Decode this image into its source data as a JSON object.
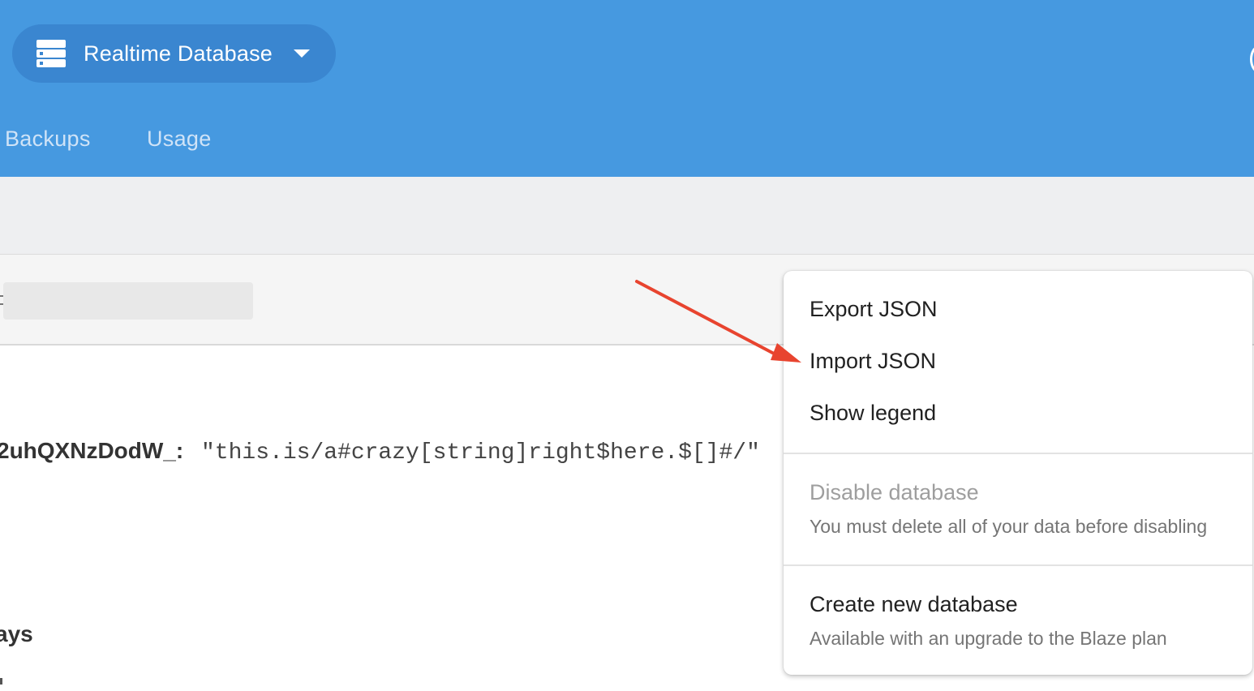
{
  "header": {
    "db_selector": {
      "title": "Realtime Database",
      "icon": "database-server-icon"
    },
    "tabs": [
      {
        "label": "Backups"
      },
      {
        "label": "Usage"
      }
    ],
    "colors": {
      "header_bg": "#4699e0",
      "selector_bg": "#3a86d0"
    }
  },
  "data_view": {
    "key": "2uhQXNzDodW_",
    "colon": ":",
    "value": "\"this.is/a#crazy[string]right$here.$[]#/\"",
    "partial_key": "ays"
  },
  "menu": {
    "items": [
      {
        "label": "Export JSON"
      },
      {
        "label": "Import JSON"
      },
      {
        "label": "Show legend"
      }
    ],
    "disable": {
      "label": "Disable database",
      "subtitle": "You must delete all of your data before disabling"
    },
    "create": {
      "label": "Create new database",
      "subtitle": "Available with an upgrade to the Blaze plan"
    }
  },
  "annotation": {
    "arrow_color": "#e8442f"
  }
}
